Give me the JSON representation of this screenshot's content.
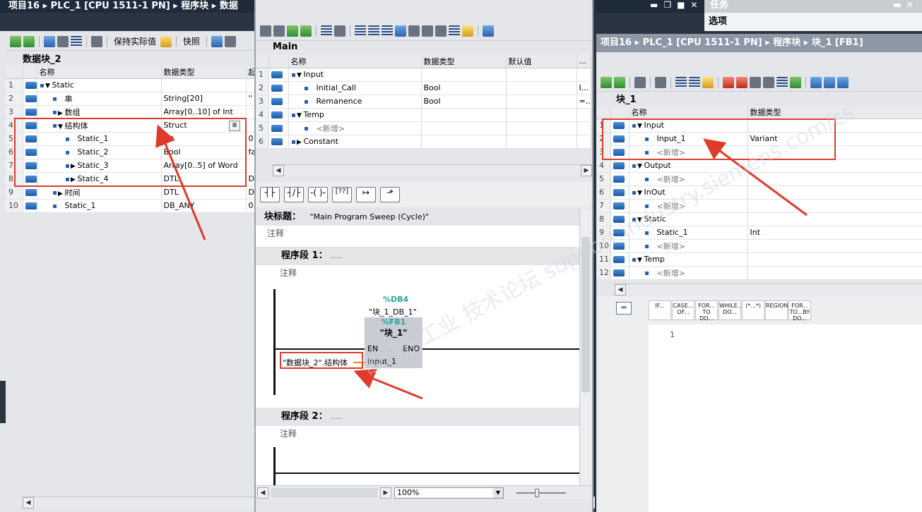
{
  "left_window": {
    "breadcrumb": [
      "项目16",
      "PLC_1 [CPU 1511-1 PN]",
      "程序块",
      "数据"
    ],
    "toolbar": {
      "keep_actual": "保持实际值",
      "snapshot": "快照"
    },
    "block_title": "数据块_2",
    "columns": [
      "名称",
      "数据类型",
      "起"
    ],
    "rows": [
      {
        "n": "1",
        "expand": "▼",
        "indent": 0,
        "name": "Static",
        "type": "",
        "start": ""
      },
      {
        "n": "2",
        "expand": "",
        "indent": 1,
        "name": "串",
        "type": "String[20]",
        "start": "''"
      },
      {
        "n": "3",
        "expand": "▶",
        "indent": 1,
        "name": "数组",
        "type": "Array[0..10] of Int",
        "start": ""
      },
      {
        "n": "4",
        "expand": "▼",
        "indent": 1,
        "name": "结构体",
        "type": "Struct",
        "start": ""
      },
      {
        "n": "5",
        "expand": "",
        "indent": 2,
        "name": "Static_1",
        "type": "Int",
        "start": "0"
      },
      {
        "n": "6",
        "expand": "",
        "indent": 2,
        "name": "Static_2",
        "type": "Bool",
        "start": "fa"
      },
      {
        "n": "7",
        "expand": "▶",
        "indent": 2,
        "name": "Static_3",
        "type": "Array[0..5] of Word",
        "start": ""
      },
      {
        "n": "8",
        "expand": "▶",
        "indent": 2,
        "name": "Static_4",
        "type": "DTL",
        "start": "DT"
      },
      {
        "n": "9",
        "expand": "▶",
        "indent": 1,
        "name": "时间",
        "type": "DTL",
        "start": "DT"
      },
      {
        "n": "10",
        "expand": "",
        "indent": 1,
        "name": "Static_1",
        "type": "DB_ANY",
        "start": "0"
      }
    ]
  },
  "middle_window": {
    "interface_title": "Main",
    "columns": [
      "名称",
      "数据类型",
      "默认值",
      "..."
    ],
    "rows": [
      {
        "n": "1",
        "expand": "▼",
        "indent": 0,
        "name": "Input",
        "type": "",
        "default": "",
        "extra": ""
      },
      {
        "n": "2",
        "expand": "",
        "indent": 1,
        "name": "Initial_Call",
        "type": "Bool",
        "default": "",
        "extra": "I..."
      },
      {
        "n": "3",
        "expand": "",
        "indent": 1,
        "name": "Remanence",
        "type": "Bool",
        "default": "",
        "extra": "=..."
      },
      {
        "n": "4",
        "expand": "▼",
        "indent": 0,
        "name": "Temp",
        "type": "",
        "default": "",
        "extra": ""
      },
      {
        "n": "5",
        "expand": "",
        "indent": 1,
        "name": "<新增>",
        "type": "",
        "default": "",
        "extra": ""
      },
      {
        "n": "6",
        "expand": "▶",
        "indent": 0,
        "name": "Constant",
        "type": "",
        "default": "",
        "extra": ""
      }
    ],
    "block_title_label": "块标题：",
    "block_title_value": "\"Main Program Sweep (Cycle)\"",
    "comment": "注释",
    "network1": "程序段 1：",
    "network2": "程序段 2：",
    "dots": ".....",
    "fb": {
      "db_address": "%DB4",
      "db_name": "\"块_1_DB_1\"",
      "fb_address": "%FB1",
      "fb_name": "\"块_1\"",
      "en": "EN",
      "eno": "ENO",
      "input": "Input_1"
    },
    "operand": "\"数据块_2\".结构体",
    "zoom": "100%"
  },
  "right_window": {
    "top_title": "任务",
    "top_sub": "选项",
    "breadcrumb": [
      "项目16",
      "PLC_1 [CPU 1511-1 PN]",
      "程序块",
      "块_1 [FB1]"
    ],
    "block_title": "块_1",
    "columns": [
      "名称",
      "数据类型"
    ],
    "rows": [
      {
        "n": "1",
        "expand": "▼",
        "indent": 0,
        "name": "Input",
        "type": ""
      },
      {
        "n": "2",
        "expand": "",
        "indent": 1,
        "name": "Input_1",
        "type": "Variant"
      },
      {
        "n": "3",
        "expand": "",
        "indent": 1,
        "name": "<新增>",
        "type": ""
      },
      {
        "n": "4",
        "expand": "▼",
        "indent": 0,
        "name": "Output",
        "type": ""
      },
      {
        "n": "5",
        "expand": "",
        "indent": 1,
        "name": "<新增>",
        "type": ""
      },
      {
        "n": "6",
        "expand": "▼",
        "indent": 0,
        "name": "InOut",
        "type": ""
      },
      {
        "n": "7",
        "expand": "",
        "indent": 1,
        "name": "<新增>",
        "type": ""
      },
      {
        "n": "8",
        "expand": "▼",
        "indent": 0,
        "name": "Static",
        "type": ""
      },
      {
        "n": "9",
        "expand": "",
        "indent": 1,
        "name": "Static_1",
        "type": "Int"
      },
      {
        "n": "10",
        "expand": "",
        "indent": 1,
        "name": "<新增>",
        "type": ""
      },
      {
        "n": "11",
        "expand": "▼",
        "indent": 0,
        "name": "Temp",
        "type": ""
      },
      {
        "n": "12",
        "expand": "",
        "indent": 1,
        "name": "<新增>",
        "type": ""
      }
    ],
    "scl_keywords": [
      "IF...",
      "CASE... OF...",
      "FOR... TO DO...",
      "WHILE.. DO...",
      "(*...*)",
      "REGION",
      "FOR... TO...BY DO..."
    ],
    "editor_line": "1"
  },
  "watermark": "西门子工业 技术论坛 support.industry.siemens.com/cs",
  "colors": {
    "highlight_red": "#e03a2a",
    "title_bg": "#1e2b3b",
    "ide_bg": "#e4e6e9",
    "fb_box": "#c9ccd3"
  }
}
